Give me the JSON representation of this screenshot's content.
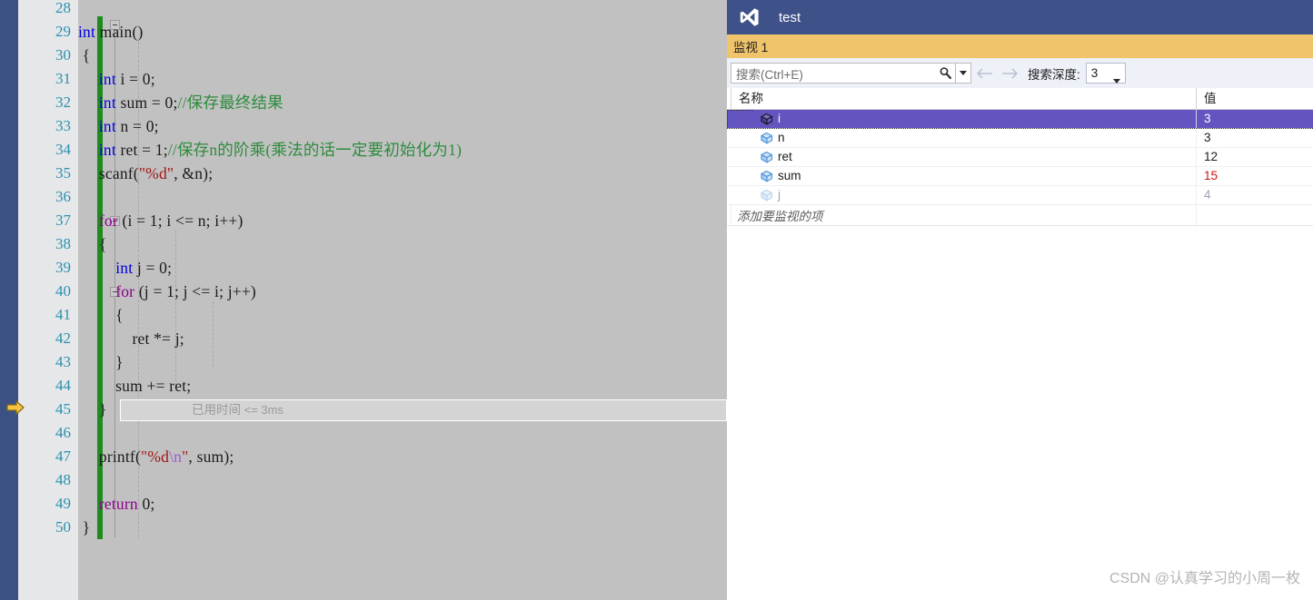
{
  "window": {
    "title": "test",
    "logo_icon": "visual-studio-logo-icon"
  },
  "editor": {
    "current_line_number": 45,
    "elapsed_time_tip_cn": "已用时间",
    "elapsed_time_tip_value": "<= 3ms",
    "lines": [
      {
        "num": "28",
        "indent": 0,
        "tokens": []
      },
      {
        "num": "29",
        "indent": 0,
        "tokens": [
          {
            "t": "kw",
            "s": "int"
          },
          {
            "t": "plain",
            "s": " main()"
          }
        ]
      },
      {
        "num": "30",
        "indent": 0,
        "tokens": [
          {
            "t": "plain",
            "s": " {"
          }
        ]
      },
      {
        "num": "31",
        "indent": 0,
        "tokens": [
          {
            "t": "plain",
            "s": "     "
          },
          {
            "t": "kw",
            "s": "int"
          },
          {
            "t": "plain",
            "s": " i = 0;"
          }
        ]
      },
      {
        "num": "32",
        "indent": 0,
        "tokens": [
          {
            "t": "plain",
            "s": "     "
          },
          {
            "t": "kw",
            "s": "int"
          },
          {
            "t": "plain",
            "s": " sum = 0;"
          },
          {
            "t": "cmt",
            "s": "//保存最终结果"
          }
        ]
      },
      {
        "num": "33",
        "indent": 0,
        "tokens": [
          {
            "t": "plain",
            "s": "     "
          },
          {
            "t": "kw",
            "s": "int"
          },
          {
            "t": "plain",
            "s": " n = 0;"
          }
        ]
      },
      {
        "num": "34",
        "indent": 0,
        "tokens": [
          {
            "t": "plain",
            "s": "     "
          },
          {
            "t": "kw",
            "s": "int"
          },
          {
            "t": "plain",
            "s": " ret = 1;"
          },
          {
            "t": "cmt",
            "s": "//保存n的阶乘(乘法的话一定要初始化为1)"
          }
        ]
      },
      {
        "num": "35",
        "indent": 0,
        "tokens": [
          {
            "t": "plain",
            "s": "     scanf("
          },
          {
            "t": "str",
            "s": "\"%d\""
          },
          {
            "t": "plain",
            "s": ", &n);"
          }
        ]
      },
      {
        "num": "36",
        "indent": 0,
        "tokens": []
      },
      {
        "num": "37",
        "indent": 0,
        "tokens": [
          {
            "t": "plain",
            "s": "     "
          },
          {
            "t": "kwctl",
            "s": "for"
          },
          {
            "t": "plain",
            "s": " (i = 1; i <= n; i++)"
          }
        ]
      },
      {
        "num": "38",
        "indent": 0,
        "tokens": [
          {
            "t": "plain",
            "s": "     {"
          }
        ]
      },
      {
        "num": "39",
        "indent": 0,
        "tokens": [
          {
            "t": "plain",
            "s": "         "
          },
          {
            "t": "kw",
            "s": "int"
          },
          {
            "t": "plain",
            "s": " j = 0;"
          }
        ]
      },
      {
        "num": "40",
        "indent": 0,
        "tokens": [
          {
            "t": "plain",
            "s": "         "
          },
          {
            "t": "kwctl",
            "s": "for"
          },
          {
            "t": "plain",
            "s": " (j = 1; j <= i; j++)"
          }
        ]
      },
      {
        "num": "41",
        "indent": 0,
        "tokens": [
          {
            "t": "plain",
            "s": "         {"
          }
        ]
      },
      {
        "num": "42",
        "indent": 0,
        "tokens": [
          {
            "t": "plain",
            "s": "             ret *= j;"
          }
        ]
      },
      {
        "num": "43",
        "indent": 0,
        "tokens": [
          {
            "t": "plain",
            "s": "         }"
          }
        ]
      },
      {
        "num": "44",
        "indent": 0,
        "tokens": [
          {
            "t": "plain",
            "s": "         sum += ret;"
          }
        ]
      },
      {
        "num": "45",
        "indent": 0,
        "tokens": [
          {
            "t": "plain",
            "s": "     }"
          }
        ]
      },
      {
        "num": "46",
        "indent": 0,
        "tokens": []
      },
      {
        "num": "47",
        "indent": 0,
        "tokens": [
          {
            "t": "plain",
            "s": "     printf("
          },
          {
            "t": "str",
            "s": "\"%d"
          },
          {
            "t": "esc",
            "s": "\\n"
          },
          {
            "t": "str",
            "s": "\""
          },
          {
            "t": "plain",
            "s": ", sum);"
          }
        ]
      },
      {
        "num": "48",
        "indent": 0,
        "tokens": []
      },
      {
        "num": "49",
        "indent": 0,
        "tokens": [
          {
            "t": "plain",
            "s": "     "
          },
          {
            "t": "kwctl",
            "s": "return"
          },
          {
            "t": "plain",
            "s": " 0;"
          }
        ]
      },
      {
        "num": "50",
        "indent": 0,
        "tokens": [
          {
            "t": "plain",
            "s": " }"
          }
        ]
      }
    ]
  },
  "watch": {
    "panel_title": "监视 1",
    "search": {
      "placeholder": "搜索(Ctrl+E)",
      "value": "",
      "icon": "magnifier-icon",
      "dropdown_icon": "chevron-down-icon"
    },
    "nav_prev_icon": "arrow-left-icon",
    "nav_next_icon": "arrow-right-icon",
    "depth_label": "搜索深度:",
    "depth_value": "3",
    "columns": {
      "name": "名称",
      "value": "值"
    },
    "rows": [
      {
        "name": "i",
        "value": "3",
        "state": "selected",
        "icon": "variable-cube-icon"
      },
      {
        "name": "n",
        "value": "3",
        "state": "normal",
        "icon": "variable-cube-icon"
      },
      {
        "name": "ret",
        "value": "12",
        "state": "normal",
        "icon": "variable-cube-icon"
      },
      {
        "name": "sum",
        "value": "15",
        "state": "changed",
        "icon": "variable-cube-icon"
      },
      {
        "name": "j",
        "value": "4",
        "state": "dim",
        "icon": "variable-cube-icon"
      }
    ],
    "add_placeholder": "添加要监视的项"
  },
  "watermark": {
    "text": "CSDN @认真学习的小周一枚"
  },
  "colors": {
    "vs_title_bar": "#3e5189",
    "watch_header": "#f0c46b",
    "selection": "#6355c0",
    "changed_value": "#d01616",
    "keyword": "#0000e0",
    "control_keyword": "#8b008b",
    "string": "#a31515",
    "comment": "#2e8b3e",
    "line_number": "#2b91af",
    "change_bar": "#1e8b1e",
    "editor_background": "#c1c1c1",
    "left_strip": "#3b5183"
  }
}
